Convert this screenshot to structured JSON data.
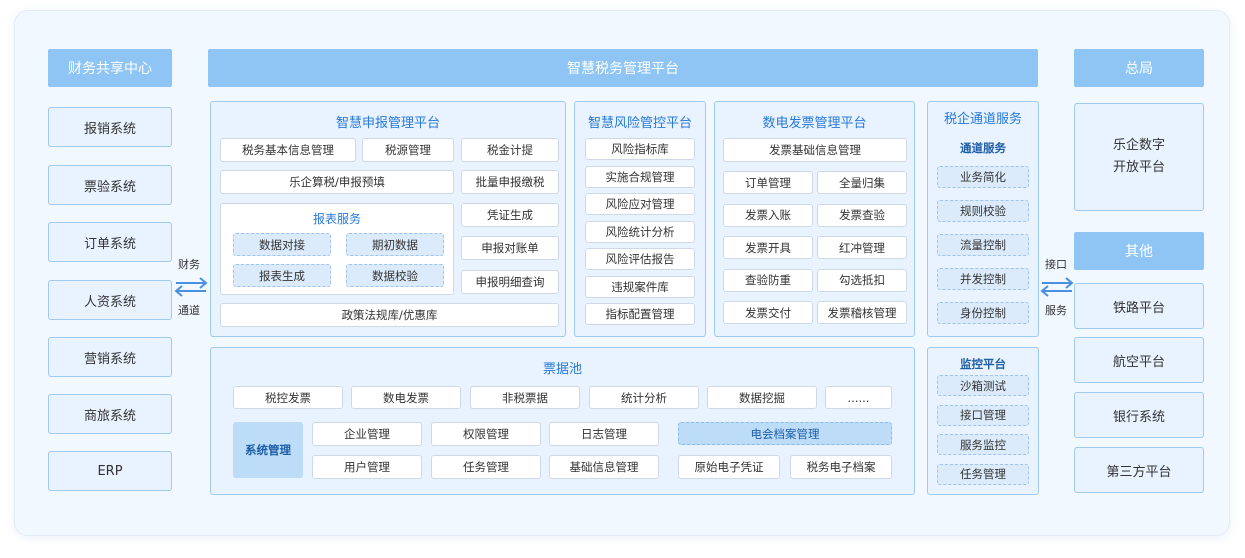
{
  "left": {
    "header": "财务共享中心",
    "items": [
      "报销系统",
      "票验系统",
      "订单系统",
      "人资系统",
      "营销系统",
      "商旅系统",
      "ERP"
    ]
  },
  "left_link": {
    "top": "财务",
    "bottom": "通道"
  },
  "main_header": "智慧税务管理平台",
  "declare": {
    "title": "智慧申报管理平台",
    "row1": [
      "税务基本信息管理",
      "税源管理",
      "税金计提"
    ],
    "row2": [
      "乐企算税/申报预填",
      "批量申报缴税"
    ],
    "report_title": "报表服务",
    "report_items": [
      "数据对接",
      "期初数据",
      "报表生成",
      "数据校验"
    ],
    "right_col": [
      "凭证生成",
      "申报对账单",
      "申报明细查询"
    ],
    "bottom": "政策法规库/优惠库"
  },
  "risk": {
    "title": "智慧风险管控平台",
    "items": [
      "风险指标库",
      "实施合规管理",
      "风险应对管理",
      "风险统计分析",
      "风险评估报告",
      "违规案件库",
      "指标配置管理"
    ]
  },
  "invoice": {
    "title": "数电发票管理平台",
    "top": "发票基础信息管理",
    "items": [
      "订单管理",
      "全量归集",
      "发票入账",
      "发票查验",
      "发票开具",
      "红冲管理",
      "查验防重",
      "勾选抵扣",
      "发票交付",
      "发票稽核管理"
    ]
  },
  "channel": {
    "title": "税企通道服务",
    "subtitle": "通道服务",
    "items": [
      "业务简化",
      "规则校验",
      "流量控制",
      "并发控制",
      "身份控制"
    ]
  },
  "pool": {
    "title": "票据池",
    "row": [
      "税控发票",
      "数电发票",
      "非税票据",
      "统计分析",
      "数据挖掘",
      "......"
    ],
    "sys_label": "系统管理",
    "sys_items": [
      "企业管理",
      "权限管理",
      "日志管理",
      "用户管理",
      "任务管理",
      "基础信息管理"
    ],
    "archive_title": "电会档案管理",
    "archive_items": [
      "原始电子凭证",
      "税务电子档案"
    ]
  },
  "monitor": {
    "title": "监控平台",
    "items": [
      "沙箱测试",
      "接口管理",
      "服务监控",
      "任务管理"
    ]
  },
  "right_link": {
    "top": "接口",
    "bottom": "服务"
  },
  "right": {
    "header": "总局",
    "open_platform": "乐企数字\n开放平台",
    "other_header": "其他",
    "items": [
      "铁路平台",
      "航空平台",
      "银行系统",
      "第三方平台"
    ]
  }
}
